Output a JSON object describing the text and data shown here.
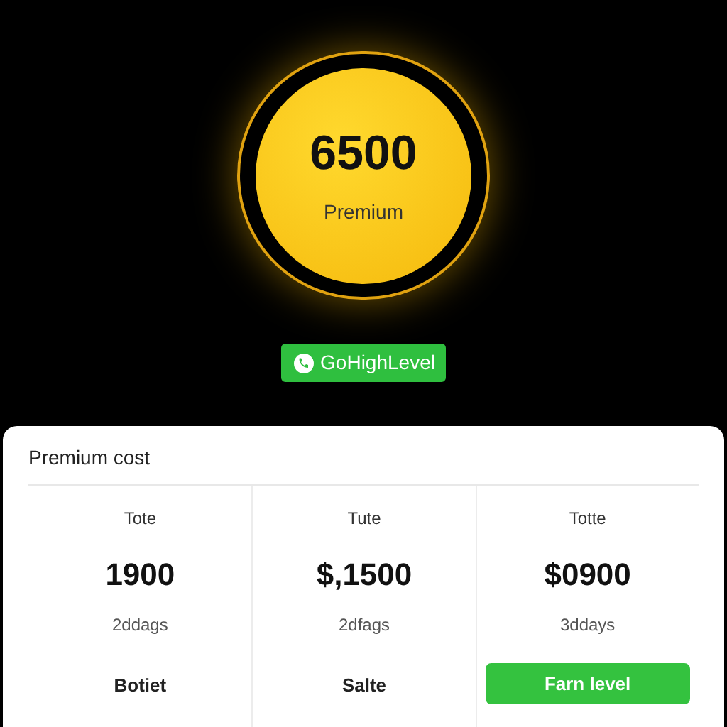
{
  "badge": {
    "value": "6500",
    "label": "Premium"
  },
  "brand_button": {
    "label": "GoHighLevel"
  },
  "card": {
    "title": "Premium cost",
    "plans": [
      {
        "label": "Tote",
        "price": "1900",
        "duration": "2ddags",
        "action": {
          "kind": "text",
          "label": "Botiet"
        }
      },
      {
        "label": "Tute",
        "price": "$,1500",
        "duration": "2dfags",
        "action": {
          "kind": "text",
          "label": "Salte"
        }
      },
      {
        "label": "Totte",
        "price": "$0900",
        "duration": "3ddays",
        "action": {
          "kind": "button",
          "label": "Farn level"
        }
      }
    ]
  }
}
